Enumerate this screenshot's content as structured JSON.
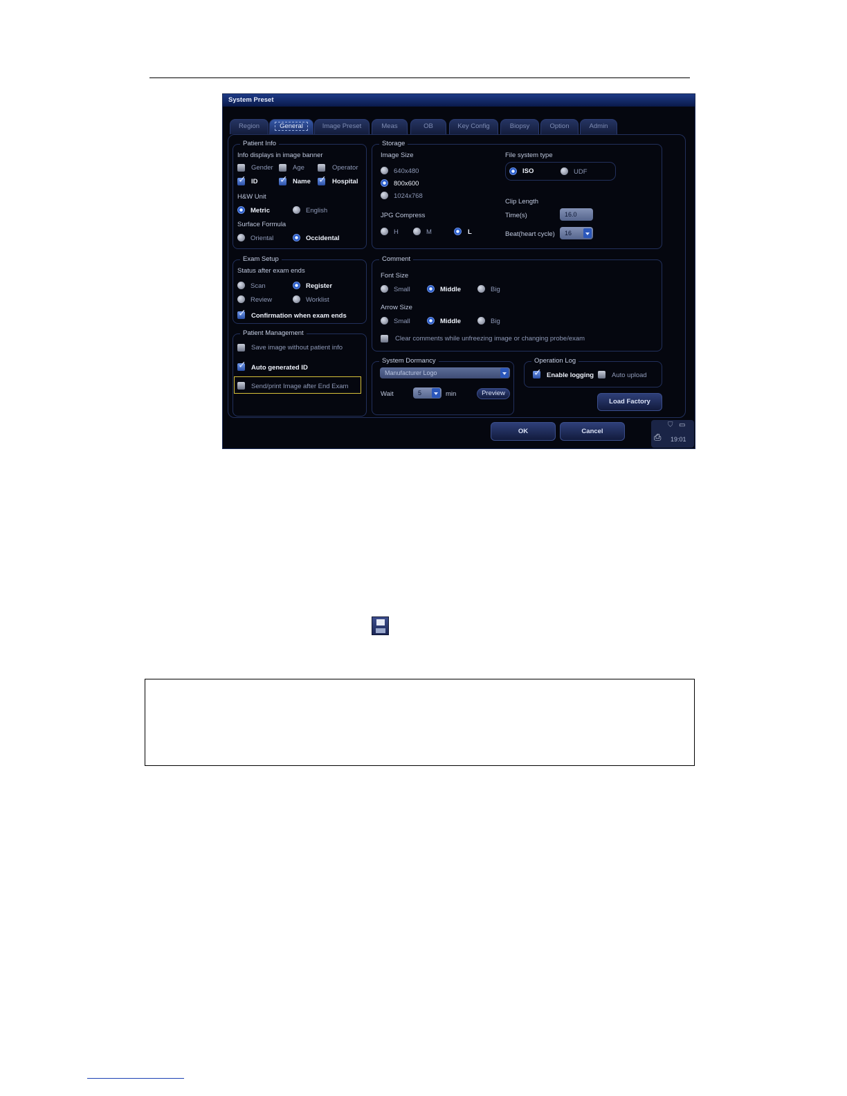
{
  "window": {
    "title": "System Preset"
  },
  "tabs": [
    "Region",
    "General",
    "Image Preset",
    "Meas",
    "OB",
    "Key Config",
    "Biopsy",
    "Option",
    "Admin"
  ],
  "active_tab": "General",
  "patient_info": {
    "legend": "Patient Info",
    "banner_label": "Info displays in image banner",
    "gender": "Gender",
    "age": "Age",
    "operator": "Operator",
    "id": "ID",
    "name": "Name",
    "hospital": "Hospital",
    "hw_unit_label": "H&W Unit",
    "metric": "Metric",
    "english": "English",
    "surface_label": "Surface Formula",
    "oriental": "Oriental",
    "occidental": "Occidental"
  },
  "exam_setup": {
    "legend": "Exam Setup",
    "status_label": "Status after exam ends",
    "scan": "Scan",
    "register": "Register",
    "review": "Review",
    "worklist": "Worklist",
    "confirm": "Confirmation when exam ends"
  },
  "patient_mgmt": {
    "legend": "Patient Management",
    "save_without": "Save image without patient info",
    "auto_id": "Auto generated ID",
    "send_print": "Send/print Image after End Exam"
  },
  "storage": {
    "legend": "Storage",
    "image_size_label": "Image Size",
    "s640": "640x480",
    "s800": "800x600",
    "s1024": "1024x768",
    "jpg_label": "JPG Compress",
    "h": "H",
    "m": "M",
    "l": "L",
    "fs_label": "File system type",
    "iso": "ISO",
    "udf": "UDF",
    "clip_label": "Clip Length",
    "time_label": "Time(s)",
    "time_value": "16.0",
    "beat_label": "Beat(heart cycle)",
    "beat_value": "16"
  },
  "comment": {
    "legend": "Comment",
    "font_label": "Font Size",
    "arrow_label": "Arrow Size",
    "small": "Small",
    "middle": "Middle",
    "big": "Big",
    "clear": "Clear comments while unfreezing image or changing probe/exam"
  },
  "dormancy": {
    "legend": "System Dormancy",
    "mode": "Manufacturer Logo",
    "wait_label": "Wait",
    "wait_value": "5",
    "unit": "min",
    "preview": "Preview"
  },
  "oplog": {
    "legend": "Operation Log",
    "enable": "Enable logging",
    "auto_upload": "Auto upload"
  },
  "buttons": {
    "load_factory": "Load Factory",
    "ok": "OK",
    "cancel": "Cancel"
  },
  "status": {
    "time": "19:01"
  }
}
